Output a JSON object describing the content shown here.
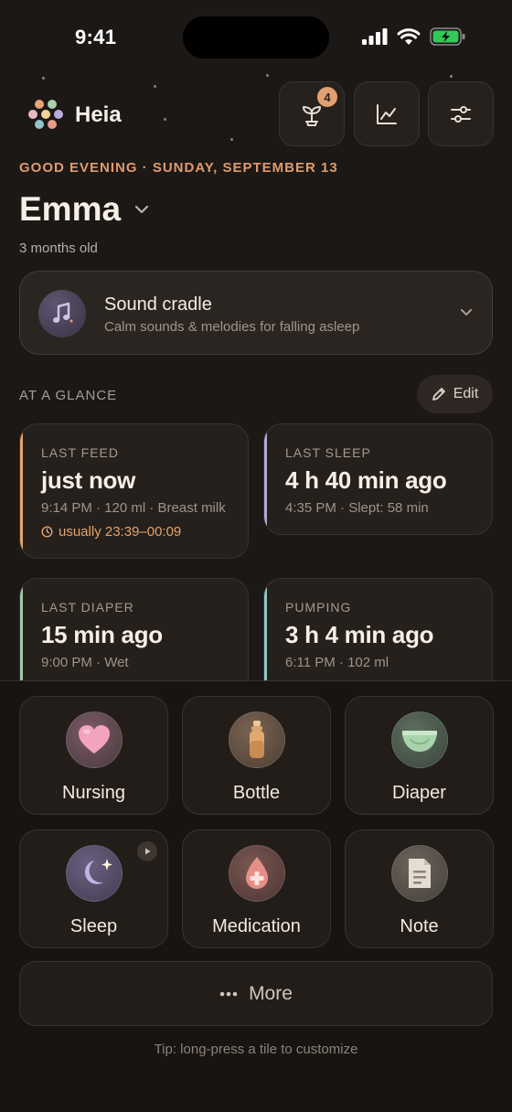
{
  "status_bar": {
    "time": "9:41"
  },
  "header": {
    "brand": "Heia",
    "growth_badge": "4"
  },
  "greeting": "GOOD EVENING · SUNDAY, SEPTEMBER 13",
  "baby": {
    "name": "Emma",
    "age": "3 months old"
  },
  "sound_cradle": {
    "title": "Sound cradle",
    "subtitle": "Calm sounds & melodies for falling asleep"
  },
  "glance": {
    "heading": "AT A GLANCE",
    "edit_label": "Edit",
    "cards": [
      {
        "title": "LAST FEED",
        "value": "just now",
        "detail": "9:14 PM · 120 ml · Breast milk",
        "usual": "usually 23:39–00:09",
        "accent": "#e2a46f"
      },
      {
        "title": "LAST SLEEP",
        "value": "4 h 40 min ago",
        "detail": "4:35 PM · Slept: 58 min",
        "accent": "#b7a8d8"
      },
      {
        "title": "LAST DIAPER",
        "value": "15 min ago",
        "detail": "9:00 PM · Wet",
        "accent": "#9cc9a6"
      },
      {
        "title": "PUMPING",
        "value": "3 h 4 min ago",
        "detail": "6:11 PM · 102 ml",
        "accent": "#8ec8c4"
      }
    ]
  },
  "tiles": [
    {
      "label": "Nursing",
      "icon": "heart-icon"
    },
    {
      "label": "Bottle",
      "icon": "bottle-icon"
    },
    {
      "label": "Diaper",
      "icon": "diaper-icon"
    },
    {
      "label": "Sleep",
      "icon": "moon-icon"
    },
    {
      "label": "Medication",
      "icon": "medication-icon"
    },
    {
      "label": "Note",
      "icon": "note-icon"
    }
  ],
  "more_label": "More",
  "tip": "Tip: long-press a tile to customize"
}
